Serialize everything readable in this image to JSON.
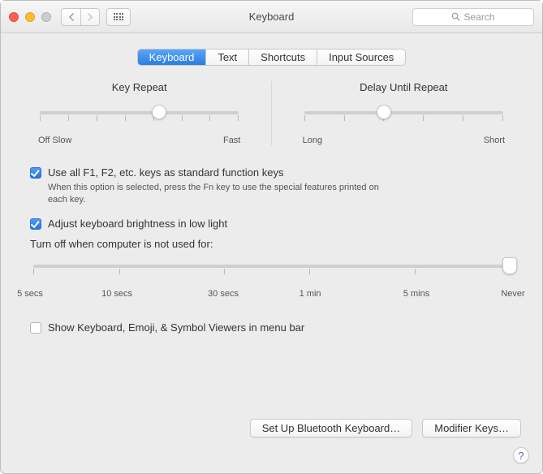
{
  "window": {
    "title": "Keyboard"
  },
  "toolbar": {
    "search_placeholder": "Search"
  },
  "tabs": [
    {
      "label": "Keyboard",
      "active": true
    },
    {
      "label": "Text",
      "active": false
    },
    {
      "label": "Shortcuts",
      "active": false
    },
    {
      "label": "Input Sources",
      "active": false
    }
  ],
  "key_repeat": {
    "title": "Key Repeat",
    "left_label_off": "Off",
    "left_label_slow": "Slow",
    "right_label": "Fast",
    "tick_count": 8,
    "knob_percent": 60
  },
  "delay_repeat": {
    "title": "Delay Until Repeat",
    "left_label": "Long",
    "right_label": "Short",
    "tick_count": 6,
    "knob_percent": 40
  },
  "options": {
    "fn_keys": {
      "checked": true,
      "label": "Use all F1, F2, etc. keys as standard function keys",
      "sublabel": "When this option is selected, press the Fn key to use the special features printed on each key."
    },
    "brightness": {
      "checked": true,
      "label": "Adjust keyboard brightness in low light"
    },
    "idle_label": "Turn off when computer is not used for:",
    "idle_slider": {
      "ticks": [
        {
          "pos": 0,
          "label": "5 secs"
        },
        {
          "pos": 18,
          "label": "10 secs"
        },
        {
          "pos": 40,
          "label": "30 secs"
        },
        {
          "pos": 58,
          "label": "1 min"
        },
        {
          "pos": 80,
          "label": "5 mins"
        },
        {
          "pos": 100,
          "label": "Never"
        }
      ],
      "knob_percent": 100
    },
    "show_viewer": {
      "checked": false,
      "label": "Show Keyboard, Emoji, & Symbol Viewers in menu bar"
    }
  },
  "buttons": {
    "bluetooth": "Set Up Bluetooth Keyboard…",
    "modifier": "Modifier Keys…"
  },
  "help": "?"
}
